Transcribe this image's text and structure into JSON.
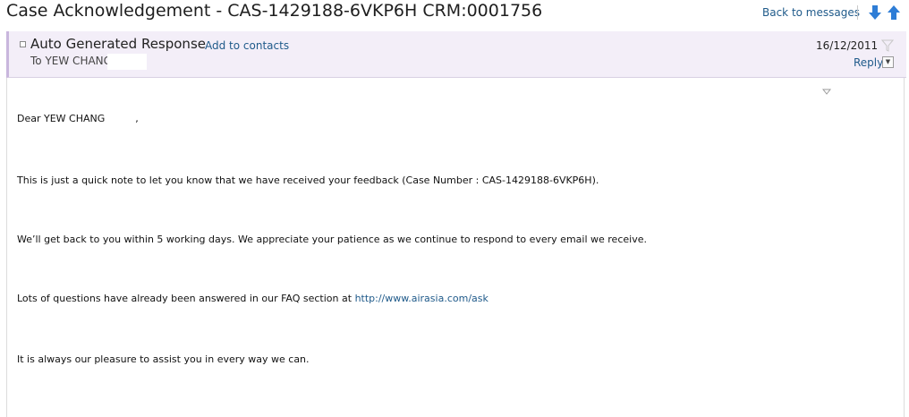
{
  "window": {
    "title": "Case Acknowledgement - CAS-1429188-6VKP6H CRM:0001756",
    "back_link": "Back to messages",
    "nav_icons": [
      "arrow-down-icon",
      "arrow-up-icon"
    ]
  },
  "message_header": {
    "sender": "Auto Generated Response",
    "add_contacts": "Add to contacts",
    "to_prefix": "To",
    "to_name": "YEW CHANG",
    "date": "16/12/2011",
    "reply_label": "Reply",
    "reply_dropdown": "▼"
  },
  "message_body": {
    "greeting_name": "Dear YEW CHANG",
    "greeting_comma": ",",
    "line1": "This is just a quick note to let you know that we have received your feedback  (Case Number : CAS-1429188-6VKP6H).",
    "line2": "We’ll get back to you within 5 working days. We appreciate your patience as we continue to respond to every email we receive.",
    "line3_text": "Lots of questions have already been answered in our FAQ section at ",
    "line3_link": "http://www.airasia.com/ask",
    "line4": "It is always our pleasure to assist you in every way we can."
  },
  "colors": {
    "link": "#1f5a8a",
    "header_bg": "#f3eef8",
    "header_accent": "#c9b6dd",
    "arrow_blue": "#2e7dd6"
  }
}
